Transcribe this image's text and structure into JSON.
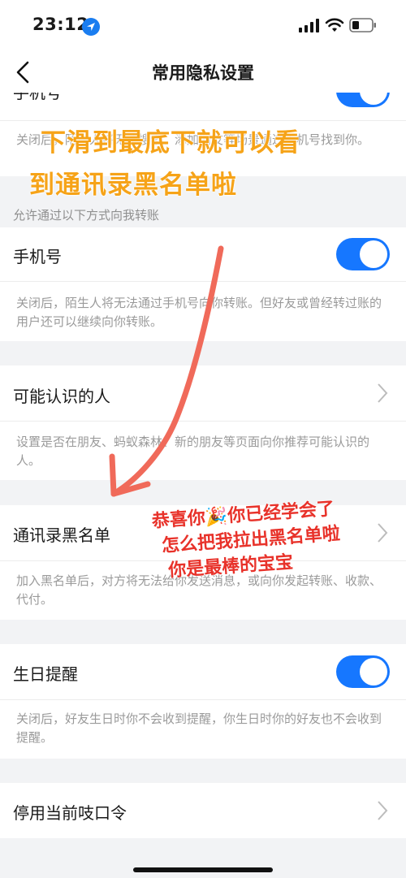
{
  "status_bar": {
    "time": "23:12"
  },
  "nav": {
    "title": "常用隐私设置"
  },
  "partial_row": {
    "label": "手机号"
  },
  "partial_desc": "关闭后，陌生人将无法搜索、添加朋友等场景通过手机号找到你。",
  "transfer_section": {
    "header": "允许通过以下方式向我转账"
  },
  "rows": {
    "phone": {
      "label": "手机号",
      "desc": "关闭后，陌生人将无法通过手机号向你转账。但好友或曾经转过账的用户还可以继续向你转账。"
    },
    "people": {
      "label": "可能认识的人",
      "desc": "设置是否在朋友、蚂蚁森林、新的朋友等页面向你推荐可能认识的人。"
    },
    "blacklist": {
      "label": "通讯录黑名单",
      "desc": "加入黑名单后，对方将无法给你发送消息，或向你发起转账、收款、代付。"
    },
    "birthday": {
      "label": "生日提醒",
      "desc": "关闭后，好友生日时你不会收到提醒，你生日时你的好友也不会收到提醒。"
    },
    "command": {
      "label": "停用当前吱口令"
    }
  },
  "annotations": {
    "top_line1": "下滑到最底下就可以看",
    "top_line2": "到通讯录黑名单啦",
    "bottom_line1": "恭喜你🎉你已经学会了",
    "bottom_line2": "怎么把我拉出黑名单啦",
    "bottom_line3": "你是最棒的宝宝"
  },
  "toggles": {
    "partial": true,
    "phone": true,
    "birthday": true
  },
  "colors": {
    "accent": "#1677ff",
    "annotation_orange": "#f6a318",
    "annotation_red": "#e8322a"
  }
}
